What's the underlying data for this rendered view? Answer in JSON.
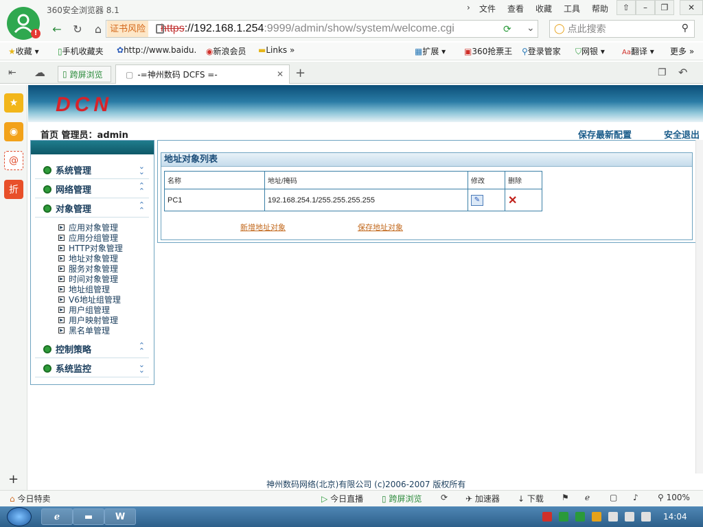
{
  "browser": {
    "app_title": "360安全浏览器 8.1",
    "menu": [
      "文件",
      "查看",
      "收藏",
      "工具",
      "帮助"
    ],
    "window_buttons": [
      "pin",
      "minimize",
      "restore",
      "close"
    ],
    "cert_warning": "证书风险",
    "url_scheme": "https",
    "url_host": "://192.168.1.254",
    "url_path": ":9999/admin/show/system/welcome.cgi",
    "search_placeholder": "点此搜索",
    "bookmarks": [
      "收藏",
      "手机收藏夹",
      "http://www.baidu.",
      "新浪会员",
      "Links"
    ],
    "bookmarks_right": [
      "扩展",
      "360抢票王",
      "登录管家",
      "网银",
      "翻译",
      "更多"
    ],
    "tabs": [
      "跨屏浏览",
      "-=神州数码 DCFS =-"
    ],
    "status_left": "今日特卖",
    "status_items": [
      "今日直播",
      "跨屏浏览",
      "加速器",
      "下载"
    ],
    "zoom": "100%"
  },
  "page": {
    "logo_text": "DCN",
    "home_label": "首页",
    "admin_label": "管理员：admin",
    "save_config": "保存最新配置",
    "logout": "安全退出",
    "menu_groups": [
      {
        "label": "系统管理"
      },
      {
        "label": "网络管理"
      },
      {
        "label": "对象管理"
      },
      {
        "label": "控制策略"
      },
      {
        "label": "系统监控"
      }
    ],
    "submenu": [
      "应用对象管理",
      "应用分组管理",
      "HTTP对象管理",
      "地址对象管理",
      "服务对象管理",
      "时间对象管理",
      "地址组管理",
      "V6地址组管理",
      "用户组管理",
      "用户映射管理",
      "黑名单管理"
    ],
    "panel_title": "地址对象列表",
    "table_headers": [
      "名称",
      "地址/掩码",
      "修改",
      "删除"
    ],
    "table_rows": [
      {
        "name": "PC1",
        "address": "192.168.254.1/255.255.255.255"
      }
    ],
    "add_link": "新增地址对象",
    "save_link": "保存地址对象",
    "footer": "神州数码网络(北京)有限公司  (c)2006-2007  版权所有"
  },
  "taskbar": {
    "clock": "14:04",
    "apps": [
      "ie",
      "explorer",
      "word"
    ]
  }
}
